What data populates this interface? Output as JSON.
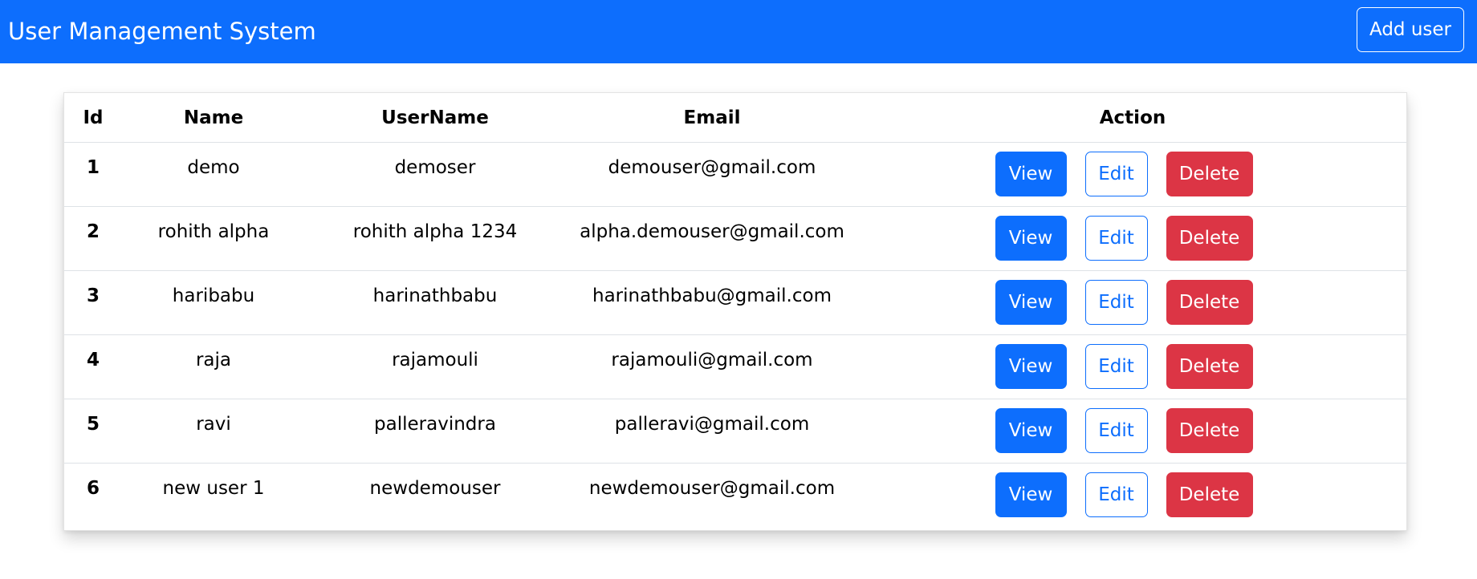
{
  "navbar": {
    "title": "User Management System",
    "add_user_label": "Add user",
    "background_color": "#0d6efd"
  },
  "table": {
    "headers": {
      "id": "Id",
      "name": "Name",
      "username": "UserName",
      "email": "Email",
      "action": "Action"
    },
    "rows": [
      {
        "id": "1",
        "name": "demo",
        "username": "demoser",
        "email": "demouser@gmail.com"
      },
      {
        "id": "2",
        "name": "rohith alpha",
        "username": "rohith alpha 1234",
        "email": "alpha.demouser@gmail.com"
      },
      {
        "id": "3",
        "name": "haribabu",
        "username": "harinathbabu",
        "email": "harinathbabu@gmail.com"
      },
      {
        "id": "4",
        "name": "raja",
        "username": "rajamouli",
        "email": "rajamouli@gmail.com"
      },
      {
        "id": "5",
        "name": "ravi",
        "username": "palleravindra",
        "email": "palleravi@gmail.com"
      },
      {
        "id": "6",
        "name": "new user 1",
        "username": "newdemouser",
        "email": "newdemouser@gmail.com"
      }
    ]
  },
  "actions": {
    "view_label": "View",
    "edit_label": "Edit",
    "delete_label": "Delete",
    "view_color": "#0d6efd",
    "edit_color": "#0d6efd",
    "delete_color": "#dc3545"
  }
}
